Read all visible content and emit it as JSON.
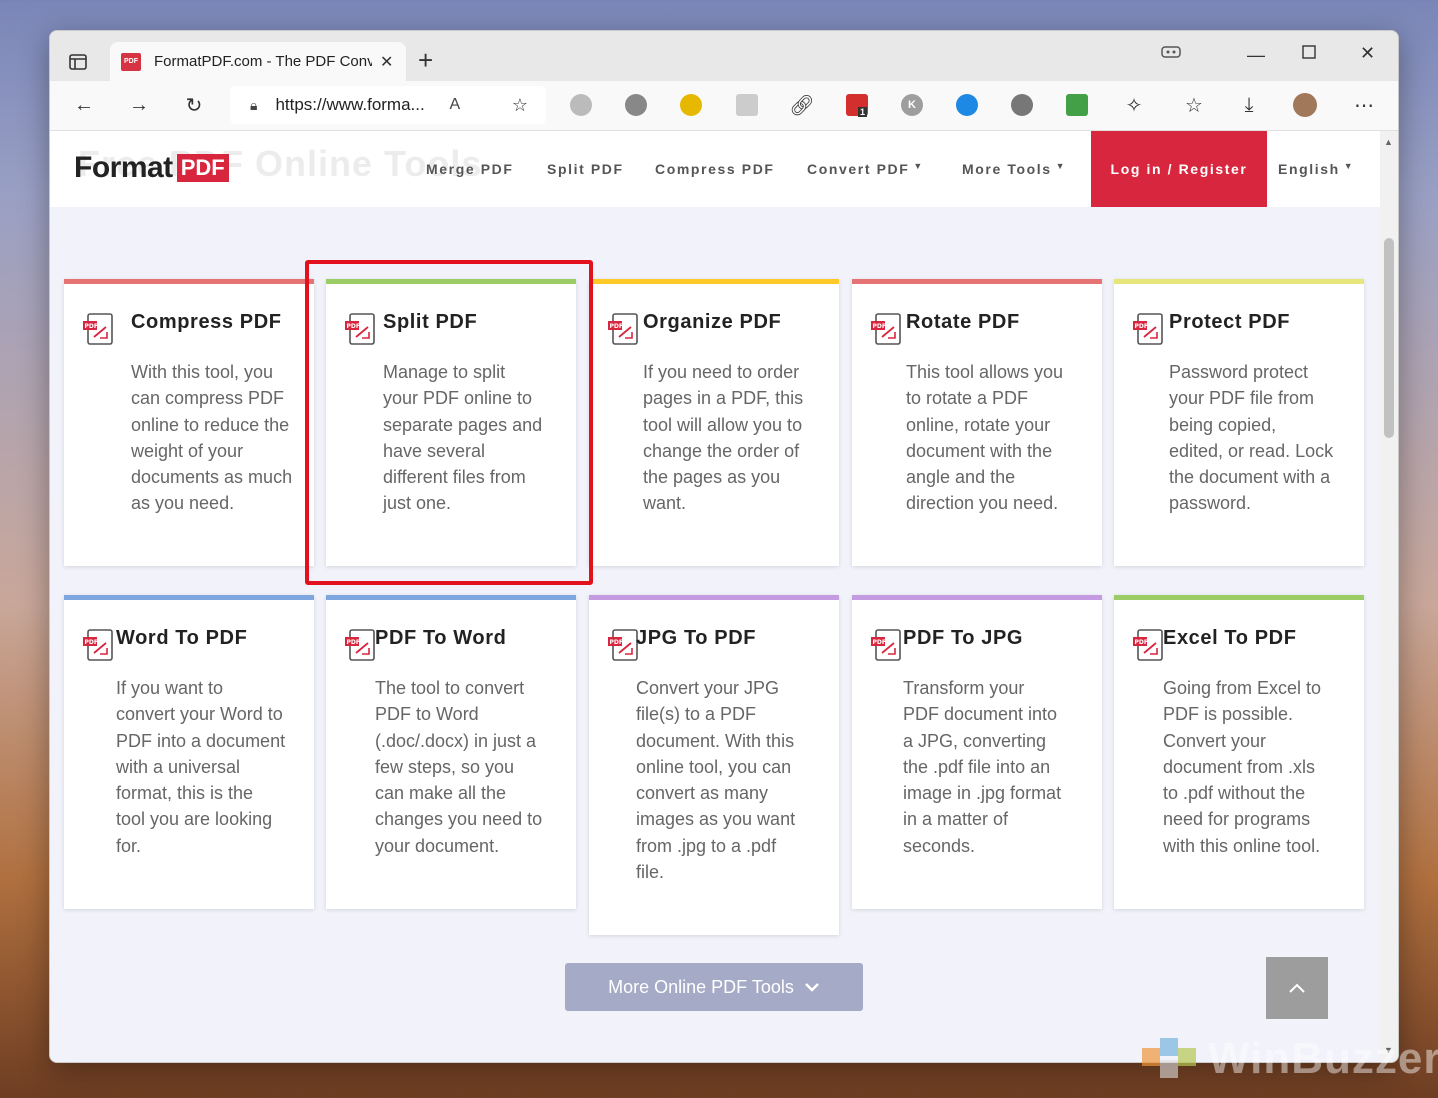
{
  "browser": {
    "tab_title": "FormatPDF.com - The PDF Conve",
    "favicon_text": "PDF",
    "url": "https://www.forma...",
    "extension_badge": "1"
  },
  "header": {
    "logo_text": "Format",
    "logo_badge": "PDF",
    "ghost_title": "Free PDF Online Tools",
    "nav": {
      "merge": "Merge PDF",
      "split": "Split PDF",
      "compress": "Compress PDF",
      "convert": "Convert PDF",
      "more": "More Tools",
      "login": "Log in / Register",
      "language": "English"
    }
  },
  "cards": [
    {
      "title": "Compress PDF",
      "desc": "With this tool, you can compress PDF online to reduce the weight of your documents as much as you need.",
      "color": "#e57373"
    },
    {
      "title": "Split PDF",
      "desc": "Manage to split your PDF online to separate pages and have several different files from just one.",
      "color": "#9ccc65"
    },
    {
      "title": "Organize PDF",
      "desc": "If you need to order pages in a PDF, this tool will allow you to change the order of the pages as you want.",
      "color": "#ffca28"
    },
    {
      "title": "Rotate PDF",
      "desc": "This tool allows you to rotate a PDF online, rotate your document with the angle and the direction you need.",
      "color": "#e57373"
    },
    {
      "title": "Protect PDF",
      "desc": "Password protect your PDF file from being copied, edited, or read. Lock the document with a password.",
      "color": "#e6e67a"
    },
    {
      "title": "Word To PDF",
      "desc": "If you want to convert your Word to PDF into a document with a universal format, this is the tool you are looking for.",
      "color": "#7fa6e0"
    },
    {
      "title": "PDF To Word",
      "desc": "The tool to convert PDF to Word (.doc/.docx) in just a few steps, so you can make all the changes you need to your document.",
      "color": "#7fa6e0"
    },
    {
      "title": "JPG To PDF",
      "desc": "Convert your JPG file(s) to a PDF document. With this online tool, you can convert as many images as you want from .jpg to a .pdf file.",
      "color": "#c49be0"
    },
    {
      "title": "PDF To JPG",
      "desc": "Transform your PDF document into a JPG, converting the .pdf file into an image in .jpg format in a matter of seconds.",
      "color": "#c49be0"
    },
    {
      "title": "Excel To PDF",
      "desc": "Going from Excel to PDF is possible. Convert your document from .xls to .pdf without the need for programs with this online tool.",
      "color": "#9ccc65"
    }
  ],
  "more_tools_button": "More Online PDF Tools",
  "watermark": "WinBuzzer"
}
